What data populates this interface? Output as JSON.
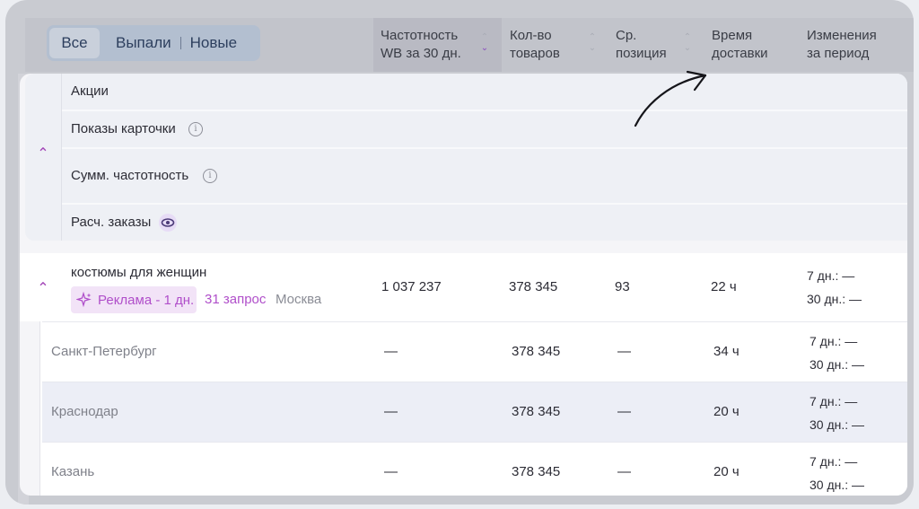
{
  "filters": {
    "all": "Все",
    "dropped": "Выпали",
    "new": "Новые"
  },
  "columns": {
    "frequency": [
      "Частотность",
      "WB за 30 дн."
    ],
    "goods_count": [
      "Кол-во",
      "товаров"
    ],
    "avg_position": [
      "Ср.",
      "позиция"
    ],
    "delivery": [
      "Время",
      "доставки"
    ],
    "changes": [
      "Изменения",
      "за период"
    ]
  },
  "metrics": {
    "promotions": "Акции",
    "card_views": "Показы карточки",
    "sum_frequency": "Сумм. частотность",
    "calc_orders": "Расч. заказы"
  },
  "query_row": {
    "title": "костюмы для женщин",
    "ad_badge": "Реклама - 1 дн.",
    "requests": "31 запрос",
    "city": "Москва",
    "frequency": "1 037 237",
    "goods_count": "378 345",
    "avg_position": "93",
    "delivery": "22 ч",
    "change_7": "7 дн.: —",
    "change_30": "30 дн.: —"
  },
  "city_rows": [
    {
      "city": "Санкт-Петербург",
      "frequency": "—",
      "goods_count": "378 345",
      "avg_position": "—",
      "delivery": "34 ч",
      "change_7": "7 дн.: —",
      "change_30": "30 дн.: —"
    },
    {
      "city": "Краснодар",
      "frequency": "—",
      "goods_count": "378 345",
      "avg_position": "—",
      "delivery": "20 ч",
      "change_7": "7 дн.: —",
      "change_30": "30 дн.: —"
    },
    {
      "city": "Казань",
      "frequency": "—",
      "goods_count": "378 345",
      "avg_position": "—",
      "delivery": "20 ч",
      "change_7": "7 дн.: —",
      "change_30": "30 дн.: —"
    }
  ],
  "colors": {
    "accent": "#b04fca",
    "overlay": "#c9cbd1"
  }
}
